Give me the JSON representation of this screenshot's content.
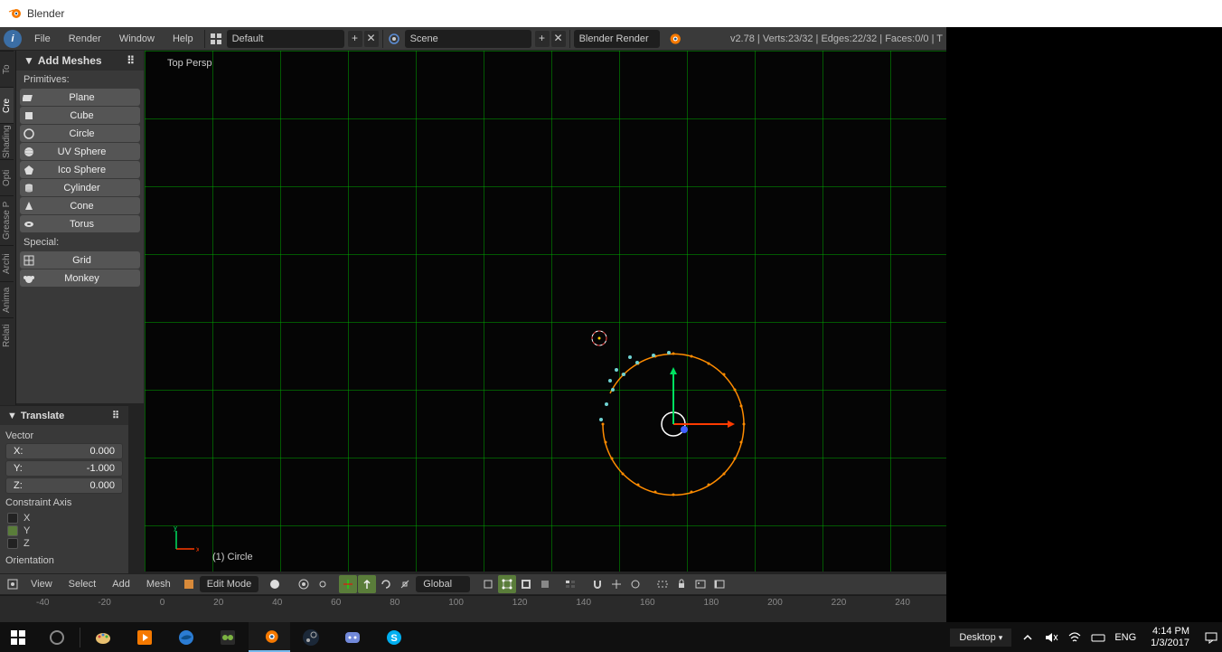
{
  "window": {
    "title": "Blender"
  },
  "menubar": {
    "items": [
      "File",
      "Render",
      "Window",
      "Help"
    ],
    "layout_selector": "Default",
    "scene_selector": "Scene",
    "render_engine": "Blender Render",
    "version_prefix": "v2.78",
    "stats": "Verts:23/32 | Edges:22/32 | Faces:0/0 | T"
  },
  "vtabs": [
    "To",
    "Cre",
    "Shading",
    "Opti",
    "Grease P",
    "Archi",
    "Anima",
    "Relati"
  ],
  "tool_panel": {
    "header": "Add Meshes",
    "section_primitives": "Primitives:",
    "primitives": [
      "Plane",
      "Cube",
      "Circle",
      "UV Sphere",
      "Ico Sphere",
      "Cylinder",
      "Cone",
      "Torus"
    ],
    "section_special": "Special:",
    "special": [
      "Grid",
      "Monkey"
    ]
  },
  "operator_panel": {
    "header": "Translate",
    "vector_label": "Vector",
    "x_label": "X:",
    "x_value": "0.000",
    "y_label": "Y:",
    "y_value": "-1.000",
    "z_label": "Z:",
    "z_value": "0.000",
    "constraint_label": "Constraint Axis",
    "cx": "X",
    "cy": "Y",
    "cz": "Z",
    "orientation_label": "Orientation"
  },
  "viewport": {
    "persp_label": "Top Persp",
    "object_label": "(1) Circle"
  },
  "viewport_header": {
    "menus": [
      "View",
      "Select",
      "Add",
      "Mesh"
    ],
    "mode": "Edit Mode",
    "orientation": "Global"
  },
  "timeline": {
    "frames": [
      "-40",
      "-20",
      "0",
      "20",
      "40",
      "60",
      "80",
      "100",
      "120",
      "140",
      "160",
      "180",
      "200",
      "220",
      "240"
    ]
  },
  "taskbar": {
    "desktop_switch": "Desktop",
    "lang": "ENG",
    "time": "4:14 PM",
    "date": "1/3/2017"
  }
}
